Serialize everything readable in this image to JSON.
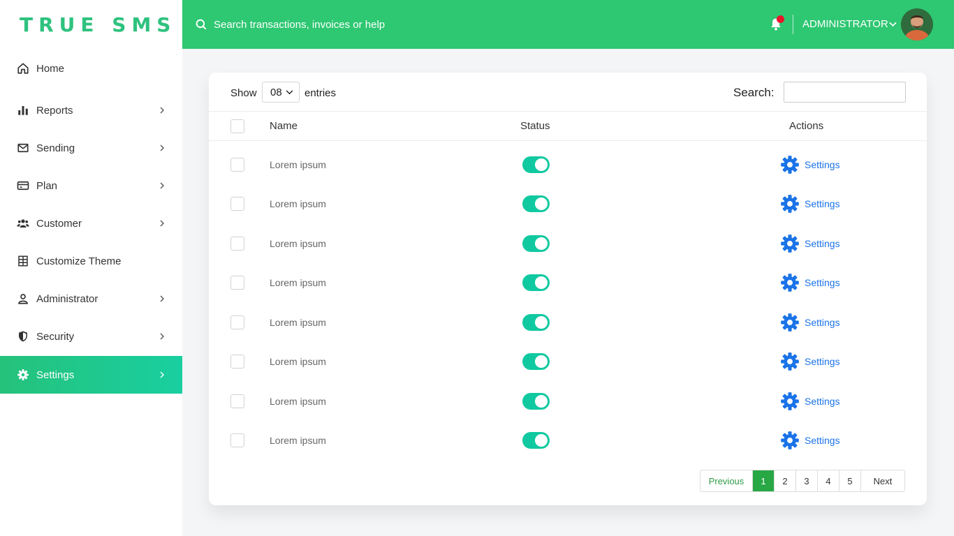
{
  "app": {
    "logo": "TRUE SMS"
  },
  "sidebar": {
    "items": [
      {
        "label": "Home",
        "icon": "home-icon",
        "chevron": false,
        "active": false
      },
      {
        "label": "Reports",
        "icon": "bar-chart-icon",
        "chevron": true,
        "active": false
      },
      {
        "label": "Sending",
        "icon": "mail-icon",
        "chevron": true,
        "active": false
      },
      {
        "label": "Plan",
        "icon": "credit-card-icon",
        "chevron": true,
        "active": false
      },
      {
        "label": "Customer",
        "icon": "users-icon",
        "chevron": true,
        "active": false
      },
      {
        "label": "Customize Theme",
        "icon": "grid-icon",
        "chevron": false,
        "active": false
      },
      {
        "label": "Administrator",
        "icon": "user-icon",
        "chevron": true,
        "active": false
      },
      {
        "label": "Security",
        "icon": "shield-icon",
        "chevron": true,
        "active": false
      },
      {
        "label": "Settings",
        "icon": "gear-icon",
        "chevron": true,
        "active": true
      }
    ]
  },
  "topbar": {
    "search_placeholder": "Search transactions, invoices or help",
    "user_name": "ADMINISTRATOR",
    "notification_dot": true
  },
  "table_controls": {
    "show_label": "Show",
    "entries_value": "08",
    "entries_label": "entries",
    "search_label": "Search:",
    "search_value": ""
  },
  "table": {
    "columns": [
      "Name",
      "Status",
      "Actions"
    ],
    "rows": [
      {
        "name": "Lorem ipsum",
        "status_on": true,
        "action": "Settings"
      },
      {
        "name": "Lorem ipsum",
        "status_on": true,
        "action": "Settings"
      },
      {
        "name": "Lorem ipsum",
        "status_on": true,
        "action": "Settings"
      },
      {
        "name": "Lorem ipsum",
        "status_on": true,
        "action": "Settings"
      },
      {
        "name": "Lorem ipsum",
        "status_on": true,
        "action": "Settings"
      },
      {
        "name": "Lorem ipsum",
        "status_on": true,
        "action": "Settings"
      },
      {
        "name": "Lorem ipsum",
        "status_on": true,
        "action": "Settings"
      },
      {
        "name": "Lorem ipsum",
        "status_on": true,
        "action": "Settings"
      }
    ]
  },
  "pagination": {
    "previous": "Previous",
    "pages": [
      "1",
      "2",
      "3",
      "4",
      "5"
    ],
    "current": "1",
    "next": "Next"
  },
  "colors": {
    "brand": "#2ec772",
    "toggle_on": "#10c9a0",
    "link": "#1a73e8",
    "active_page": "#28a745",
    "notification": "#e8152a"
  }
}
